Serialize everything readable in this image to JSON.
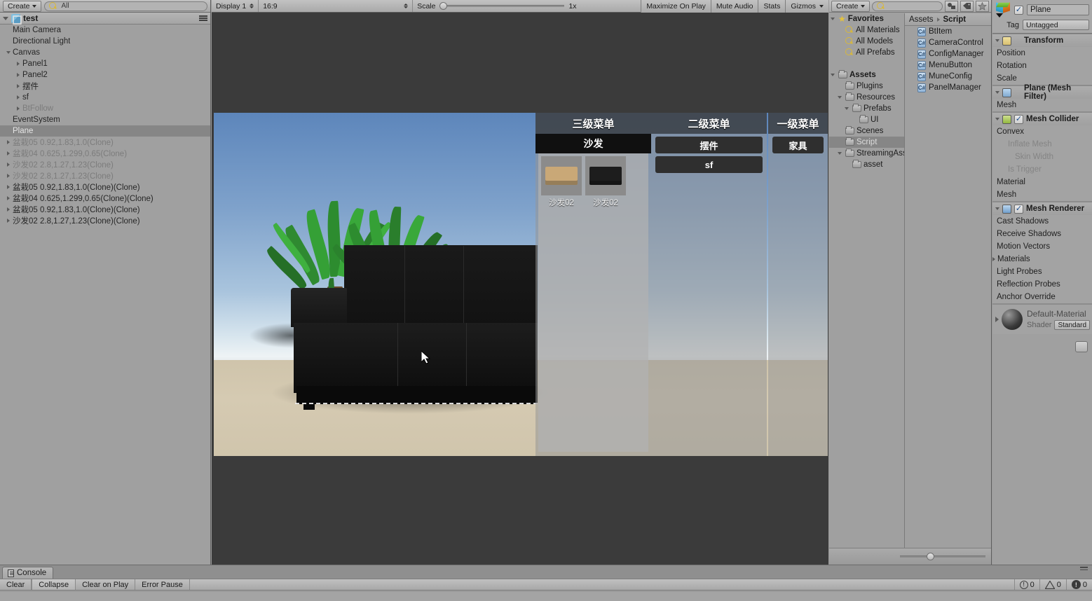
{
  "hierarchy": {
    "create_label": "Create",
    "search_placeholder": "All",
    "scene_name": "test",
    "items": [
      {
        "label": "Main Camera",
        "depth": 1,
        "arrow": "none",
        "state": "normal"
      },
      {
        "label": "Directional Light",
        "depth": 1,
        "arrow": "none",
        "state": "normal"
      },
      {
        "label": "Canvas",
        "depth": 1,
        "arrow": "down",
        "state": "normal"
      },
      {
        "label": "Panel1",
        "depth": 2,
        "arrow": "right",
        "state": "normal"
      },
      {
        "label": "Panel2",
        "depth": 2,
        "arrow": "right",
        "state": "normal"
      },
      {
        "label": "摆件",
        "depth": 2,
        "arrow": "right",
        "state": "normal"
      },
      {
        "label": "sf",
        "depth": 2,
        "arrow": "right",
        "state": "normal"
      },
      {
        "label": "BtFollow",
        "depth": 2,
        "arrow": "right",
        "state": "dim"
      },
      {
        "label": "EventSystem",
        "depth": 1,
        "arrow": "none",
        "state": "normal"
      },
      {
        "label": "Plane",
        "depth": 1,
        "arrow": "none",
        "state": "selected"
      },
      {
        "label": "盆栽05 0.92,1.83,1.0(Clone)",
        "depth": 1,
        "arrow": "right",
        "state": "dim"
      },
      {
        "label": "盆栽04 0.625,1.299,0.65(Clone)",
        "depth": 1,
        "arrow": "right",
        "state": "dim"
      },
      {
        "label": "沙发02 2.8,1.27,1.23(Clone)",
        "depth": 1,
        "arrow": "right",
        "state": "dim"
      },
      {
        "label": "沙发02 2.8,1.27,1.23(Clone)",
        "depth": 1,
        "arrow": "right",
        "state": "dim"
      },
      {
        "label": "盆栽05 0.92,1.83,1.0(Clone)(Clone)",
        "depth": 1,
        "arrow": "right",
        "state": "normal"
      },
      {
        "label": "盆栽04 0.625,1.299,0.65(Clone)(Clone)",
        "depth": 1,
        "arrow": "right",
        "state": "normal"
      },
      {
        "label": "盆栽05 0.92,1.83,1.0(Clone)(Clone)",
        "depth": 1,
        "arrow": "right",
        "state": "normal"
      },
      {
        "label": "沙发02 2.8,1.27,1.23(Clone)(Clone)",
        "depth": 1,
        "arrow": "right",
        "state": "normal"
      }
    ]
  },
  "gameview": {
    "display": "Display 1",
    "aspect": "16:9",
    "scale_label": "Scale",
    "scale_value": "1x",
    "maximize_on_play": "Maximize On Play",
    "mute_audio": "Mute Audio",
    "stats": "Stats",
    "gizmos": "Gizmos",
    "ingame": {
      "level3": {
        "title": "三级菜单",
        "category": "沙发",
        "items": [
          {
            "name": "沙发02",
            "color": "#c9a877"
          },
          {
            "name": "沙发02",
            "color": "#1d1d1d"
          }
        ]
      },
      "level2": {
        "title": "二级菜单",
        "buttons": [
          "摆件",
          "sf"
        ]
      },
      "level1": {
        "title": "一级菜单",
        "buttons": [
          "家具"
        ]
      }
    }
  },
  "project": {
    "create_label": "Create",
    "search_placeholder": "",
    "breadcrumb_root": "Assets",
    "breadcrumb_current": "Script",
    "tree": [
      {
        "label": "Favorites",
        "depth": 0,
        "arrow": "down",
        "icon": "star",
        "bold": true,
        "state": "normal"
      },
      {
        "label": "All Materials",
        "depth": 1,
        "arrow": "none",
        "icon": "search",
        "bold": false,
        "state": "normal"
      },
      {
        "label": "All Models",
        "depth": 1,
        "arrow": "none",
        "icon": "search",
        "bold": false,
        "state": "normal"
      },
      {
        "label": "All Prefabs",
        "depth": 1,
        "arrow": "none",
        "icon": "search",
        "bold": false,
        "state": "normal"
      },
      {
        "label": "",
        "depth": 0,
        "arrow": "none",
        "icon": "none",
        "bold": false,
        "state": "spacer"
      },
      {
        "label": "Assets",
        "depth": 0,
        "arrow": "down",
        "icon": "folder",
        "bold": true,
        "state": "normal"
      },
      {
        "label": "Plugins",
        "depth": 1,
        "arrow": "none",
        "icon": "folder",
        "bold": false,
        "state": "normal"
      },
      {
        "label": "Resources",
        "depth": 1,
        "arrow": "down",
        "icon": "folder",
        "bold": false,
        "state": "normal"
      },
      {
        "label": "Prefabs",
        "depth": 2,
        "arrow": "down",
        "icon": "folder",
        "bold": false,
        "state": "normal"
      },
      {
        "label": "UI",
        "depth": 3,
        "arrow": "none",
        "icon": "folder",
        "bold": false,
        "state": "normal"
      },
      {
        "label": "Scenes",
        "depth": 1,
        "arrow": "none",
        "icon": "folder",
        "bold": false,
        "state": "normal"
      },
      {
        "label": "Script",
        "depth": 1,
        "arrow": "none",
        "icon": "folder",
        "bold": false,
        "state": "selected"
      },
      {
        "label": "StreamingAssets",
        "depth": 1,
        "arrow": "down",
        "icon": "folder",
        "bold": false,
        "state": "normal"
      },
      {
        "label": "asset",
        "depth": 2,
        "arrow": "none",
        "icon": "folder",
        "bold": false,
        "state": "normal"
      }
    ],
    "files": [
      {
        "label": "BtItem",
        "icon": "csharp-script"
      },
      {
        "label": "CameraControl",
        "icon": "csharp-script"
      },
      {
        "label": "ConfigManager",
        "icon": "csharp-script"
      },
      {
        "label": "MenuButton",
        "icon": "csharp-script"
      },
      {
        "label": "MuneConfig",
        "icon": "csharp-script"
      },
      {
        "label": "PanelManager",
        "icon": "csharp-script"
      }
    ]
  },
  "inspector": {
    "object_name": "Plane",
    "object_enabled": true,
    "tag_label": "Tag",
    "tag_value": "Untagged",
    "components": [
      {
        "title": "Transform",
        "icon": "transform-icon",
        "has_checkbox": false,
        "props": [
          {
            "label": "Position",
            "indent": 0,
            "disabled": false,
            "foldout": false
          },
          {
            "label": "Rotation",
            "indent": 0,
            "disabled": false,
            "foldout": false
          },
          {
            "label": "Scale",
            "indent": 0,
            "disabled": false,
            "foldout": false
          }
        ]
      },
      {
        "title": "Plane (Mesh Filter)",
        "icon": "mesh-filter-icon",
        "has_checkbox": false,
        "props": [
          {
            "label": "Mesh",
            "indent": 0,
            "disabled": false,
            "foldout": false
          }
        ]
      },
      {
        "title": "Mesh Collider",
        "icon": "mesh-collider-icon",
        "has_checkbox": true,
        "props": [
          {
            "label": "Convex",
            "indent": 0,
            "disabled": false,
            "foldout": false
          },
          {
            "label": "Inflate Mesh",
            "indent": 1,
            "disabled": true,
            "foldout": false
          },
          {
            "label": "Skin Width",
            "indent": 2,
            "disabled": true,
            "foldout": false
          },
          {
            "label": "Is Trigger",
            "indent": 1,
            "disabled": true,
            "foldout": false
          },
          {
            "label": "Material",
            "indent": 0,
            "disabled": false,
            "foldout": false
          },
          {
            "label": "Mesh",
            "indent": 0,
            "disabled": false,
            "foldout": false
          }
        ]
      },
      {
        "title": "Mesh Renderer",
        "icon": "mesh-renderer-icon",
        "has_checkbox": true,
        "props": [
          {
            "label": "Cast Shadows",
            "indent": 0,
            "disabled": false,
            "foldout": false
          },
          {
            "label": "Receive Shadows",
            "indent": 0,
            "disabled": false,
            "foldout": false
          },
          {
            "label": "Motion Vectors",
            "indent": 0,
            "disabled": false,
            "foldout": false
          },
          {
            "label": "Materials",
            "indent": 0,
            "disabled": false,
            "foldout": true
          },
          {
            "label": "Light Probes",
            "indent": 0,
            "disabled": false,
            "foldout": false
          },
          {
            "label": "Reflection Probes",
            "indent": 0,
            "disabled": false,
            "foldout": false
          },
          {
            "label": "Anchor Override",
            "indent": 0,
            "disabled": false,
            "foldout": false
          }
        ]
      }
    ],
    "material": {
      "name": "Default-Material",
      "shader_label": "Shader",
      "shader_value": "Standard"
    }
  },
  "console": {
    "tab_label": "Console",
    "buttons": [
      "Clear",
      "Collapse",
      "Clear on Play",
      "Error Pause"
    ],
    "active_button": "Collapse",
    "info_count": "0",
    "warning_count": "0",
    "error_count": "0"
  }
}
